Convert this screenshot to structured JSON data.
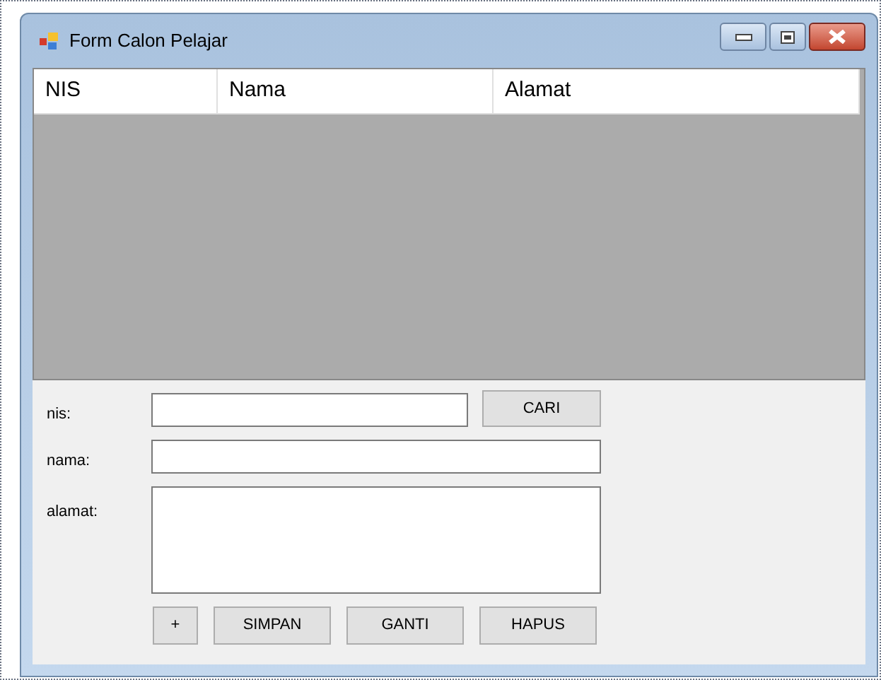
{
  "window": {
    "title": "Form Calon Pelajar"
  },
  "table": {
    "columns": [
      "NIS",
      "Nama",
      "Alamat"
    ]
  },
  "form": {
    "fields": [
      {
        "label": "nis:",
        "kind": "line"
      },
      {
        "label": "nama:",
        "kind": "line"
      },
      {
        "label": "alamat:",
        "kind": "multiline"
      }
    ],
    "search_button": "CARI",
    "buttons": [
      "+",
      "SIMPAN",
      "GANTI",
      "HAPUS"
    ]
  }
}
